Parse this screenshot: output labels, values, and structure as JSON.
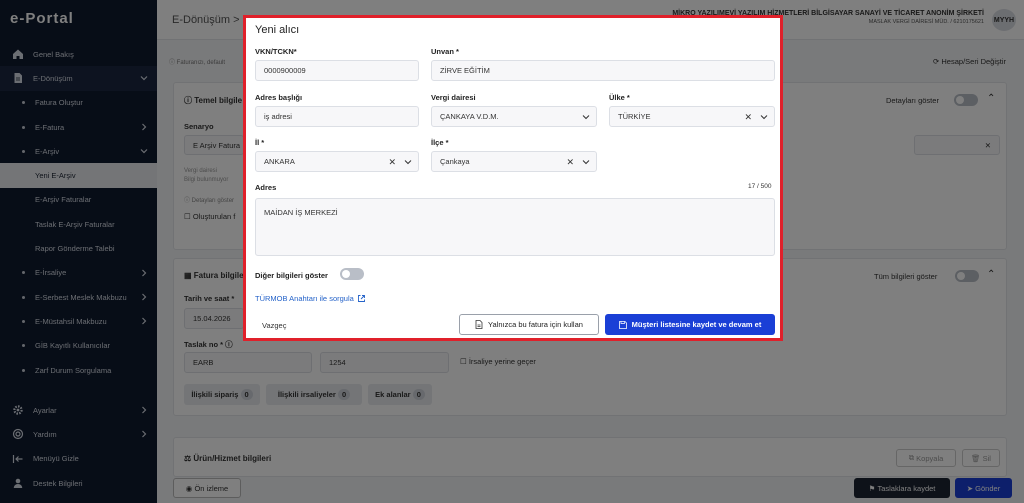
{
  "app": {
    "logo": "e-Portal"
  },
  "sidebar": {
    "items": [
      {
        "label": "Genel Bakış"
      },
      {
        "label": "E-Dönüşüm"
      },
      {
        "label": "Fatura Oluştur"
      },
      {
        "label": "E-Fatura"
      },
      {
        "label": "E-Arşiv"
      },
      {
        "label": "Yeni E-Arşiv"
      },
      {
        "label": "E-Arşiv Faturalar"
      },
      {
        "label": "Taslak E-Arşiv Faturalar"
      },
      {
        "label": "Rapor Gönderme Talebi"
      },
      {
        "label": "E-İrsaliye"
      },
      {
        "label": "E-Serbest Meslek Makbuzu"
      },
      {
        "label": "E-Müstahsil Makbuzu"
      },
      {
        "label": "GİB Kayıtlı Kullanıcılar"
      },
      {
        "label": "Zarf Durum Sorgulama"
      }
    ],
    "bottom": [
      {
        "label": "Ayarlar"
      },
      {
        "label": "Yardım"
      },
      {
        "label": "Menüyü Gizle"
      },
      {
        "label": "Destek Bilgileri"
      }
    ]
  },
  "topbar": {
    "breadcrumb": "E-Dönüşüm",
    "company": "MİKRO YAZILIMEVİ YAZILIM HİZMETLERİ BİLGİSAYAR SANAYİ VE TİCARET ANONİM ŞİRKETİ",
    "company_sub": "MASLAK VERGİ DAİRESİ MÜD. / 6210175621",
    "avatar": "MYYH"
  },
  "page": {
    "info_text": "Faturanızı, default",
    "account_change": "Hesap/Seri Değiştir",
    "basic_info": "Temel bilgile",
    "show_details": "Detayları göster",
    "scenario_label": "Senaryo",
    "scenario_value": "E Arşiv Fatura",
    "vergi_dairesi_hint": "Vergi dairesi",
    "bilgi_hint": "Bilgi bulunmuyor",
    "detay_hint": "Detayları göster",
    "olusturulan": "Oluşturulan f",
    "invoice_info": "Fatura bilgile",
    "show_all": "Tüm bilgileri göster",
    "date_label": "Tarih ve saat *",
    "date_value": "15.04.2026",
    "draft_label": "Taslak no *",
    "draft_prefix": "EARB",
    "draft_number": "1254",
    "irsaliye": "İrsaliye yerine geçer",
    "tabs": [
      {
        "label": "İlişkili sipariş",
        "count": "0"
      },
      {
        "label": "İlişkili irsaliyeler",
        "count": "0"
      },
      {
        "label": "Ek alanlar",
        "count": "0"
      }
    ],
    "product_info": "Ürün/Hizmet bilgileri",
    "copy_btn": "Kopyala",
    "delete_btn": "Sil",
    "preview_btn": "Ön izleme",
    "save_draft_btn": "Taslaklara kaydet",
    "send_btn": "Gönder"
  },
  "modal": {
    "title": "Yeni alıcı",
    "vkn_label": "VKN/TCKN*",
    "vkn_value": "0000900009",
    "unvan_label": "Unvan *",
    "unvan_value": "ZİRVE EĞİTİM",
    "adres_basligi_label": "Adres başlığı",
    "adres_basligi_value": "iş adresi",
    "vergi_dairesi_label": "Vergi dairesi",
    "vergi_dairesi_value": "ÇANKAYA V.D.M.",
    "ulke_label": "Ülke *",
    "ulke_value": "TÜRKİYE",
    "il_label": "İl *",
    "il_value": "ANKARA",
    "ilce_label": "İlçe *",
    "ilce_value": "Çankaya",
    "adres_label": "Adres",
    "adres_counter": "17 / 500",
    "adres_value": "MAİDAN İŞ MERKEZİ",
    "other_info": "Diğer bilgileri göster",
    "turmob_link": "TÜRMOB Anahtarı ile sorgula",
    "cancel": "Vazgeç",
    "only_invoice_btn": "Yalnızca bu fatura için kullan",
    "save_continue_btn": "Müşteri listesine kaydet ve devam et"
  },
  "colors": {
    "sidebar": "#0f1a2e",
    "primary": "#1a3fd6",
    "highlight": "#e0202a",
    "dark_btn": "#1c2433"
  }
}
